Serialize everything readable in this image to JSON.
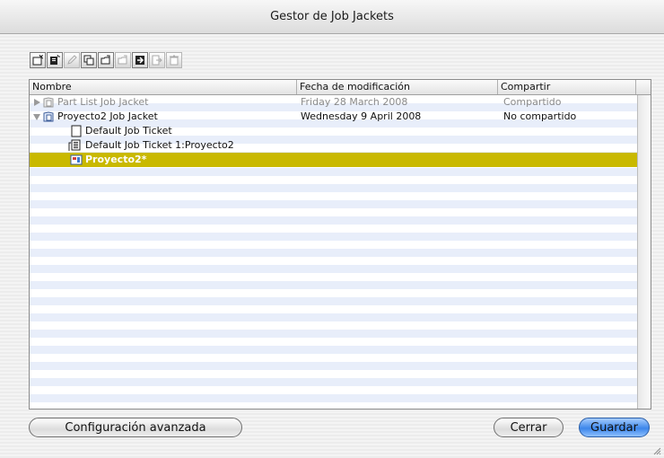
{
  "window": {
    "title": "Gestor de Job Jackets"
  },
  "toolbar": {
    "buttons": [
      {
        "icon": "new-job-jacket-icon",
        "enabled": true
      },
      {
        "icon": "new-ticket-icon",
        "enabled": true
      },
      {
        "icon": "edit-pencil-icon",
        "enabled": false
      },
      {
        "icon": "duplicate-icon",
        "enabled": true
      },
      {
        "icon": "open-folder-icon",
        "enabled": true
      },
      {
        "icon": "open-folder-alt-icon",
        "enabled": false
      },
      {
        "icon": "import-icon",
        "enabled": true
      },
      {
        "icon": "export-icon",
        "enabled": false
      },
      {
        "icon": "trash-icon",
        "enabled": false
      }
    ]
  },
  "table": {
    "columns": [
      "Nombre",
      "Fecha de modificación",
      "Compartir"
    ],
    "rows": [
      {
        "name": "Part List Job Jacket",
        "date": "Friday 28 March 2008",
        "share": "Compartido",
        "state": "dim",
        "icon": "jacket-icon"
      },
      {
        "name": "Proyecto2 Job Jacket",
        "date": "Wednesday 9 April 2008",
        "share": "No compartido",
        "state": "normal",
        "icon": "jacket-icon"
      },
      {
        "name": "Default Job Ticket",
        "date": "",
        "share": "",
        "state": "normal",
        "icon": "ticket-icon"
      },
      {
        "name": "Default Job Ticket 1:Proyecto2",
        "date": "",
        "share": "",
        "state": "normal",
        "icon": "ticket-linked-icon"
      },
      {
        "name": "Proyecto2*",
        "date": "",
        "share": "",
        "state": "selected",
        "icon": "layout-icon"
      }
    ]
  },
  "buttons": {
    "advanced": "Configuración avanzada",
    "close": "Cerrar",
    "save": "Guardar"
  },
  "colors": {
    "selection": "#c9b900",
    "primary_button": "#3c86ea"
  }
}
